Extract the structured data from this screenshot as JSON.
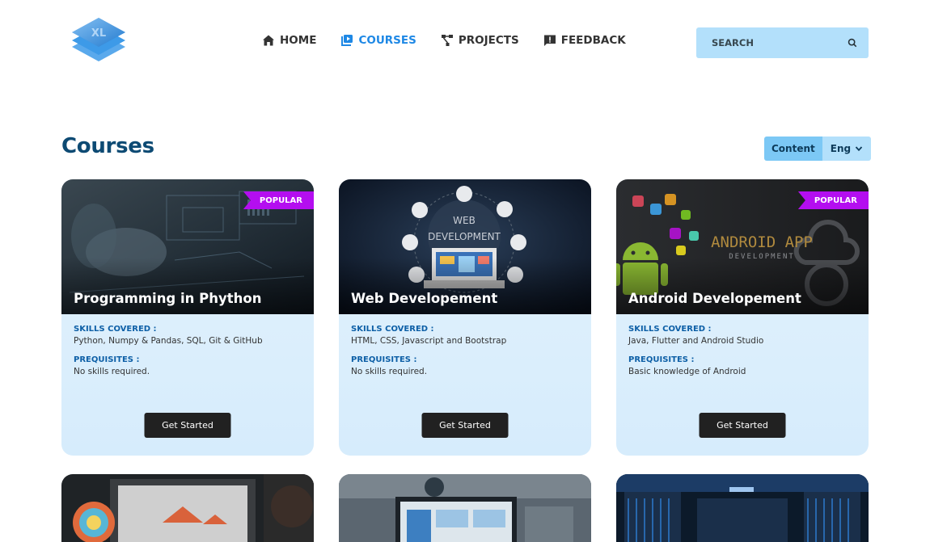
{
  "header": {
    "logo_text": "XL",
    "nav": [
      {
        "label": "HOME",
        "icon": "home-icon"
      },
      {
        "label": "COURSES",
        "icon": "video-library-icon",
        "active": true
      },
      {
        "label": "PROJECTS",
        "icon": "flowchart-icon"
      },
      {
        "label": "FEEDBACK",
        "icon": "feedback-icon"
      }
    ],
    "search": {
      "placeholder": "SEARCH",
      "icon": "search-icon"
    }
  },
  "main": {
    "title": "Courses",
    "filter": {
      "content_label": "Content",
      "language_value": "Eng"
    },
    "courses": [
      {
        "title": "Programming in Phython",
        "badge": "POPULAR",
        "skills_label": "SKILLS COVERED :",
        "skills": "Python, Numpy & Pandas, SQL, Git & GitHub",
        "prereq_label": "PREQUISITES :",
        "prereq": "No skills required.",
        "button": "Get Started"
      },
      {
        "title": "Web Developement",
        "image_text_1": "WEB",
        "image_text_2": "DEVELOPMENT",
        "skills_label": "SKILLS COVERED :",
        "skills": "HTML, CSS, Javascript and Bootstrap",
        "prereq_label": "PREQUISITES :",
        "prereq": "No skills required.",
        "button": "Get Started"
      },
      {
        "title": "Android Developement",
        "badge": "POPULAR",
        "image_text_1": "ANDROID APP",
        "image_text_2": "DEVELOPMENT",
        "skills_label": "SKILLS COVERED :",
        "skills": "Java, Flutter and Android Studio",
        "prereq_label": "PREQUISITES :",
        "prereq": "Basic knowledge of Android",
        "button": "Get Started"
      }
    ]
  },
  "colors": {
    "accent": "#1e88e5",
    "title": "#0d4a73",
    "badge": "#b40ef0",
    "search_bg": "#b3e0fb"
  }
}
